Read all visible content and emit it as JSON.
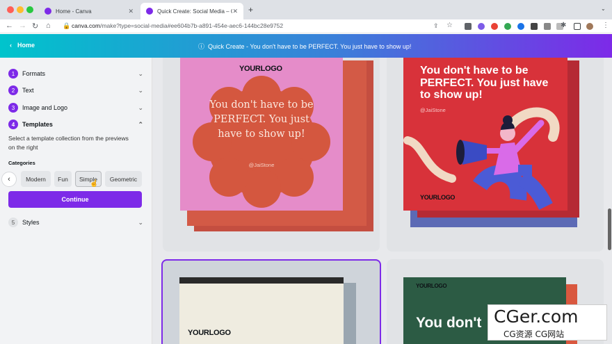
{
  "browser": {
    "tabs": [
      {
        "title": "Home - Canva"
      },
      {
        "title": "Quick Create: Social Media – C"
      }
    ],
    "new_tab": "+",
    "url_host": "canva.com",
    "url_rest": "/make?type=social-media#ee604b7b-a891-454e-aec6-144bc28e9752"
  },
  "banner": {
    "home_label": "Home",
    "message": "Quick Create - You don't have to be PERFECT. You just have to show up!"
  },
  "sidebar": {
    "steps": [
      {
        "num": "1",
        "label": "Formats"
      },
      {
        "num": "2",
        "label": "Text"
      },
      {
        "num": "3",
        "label": "Image and Logo"
      },
      {
        "num": "4",
        "label": "Templates"
      },
      {
        "num": "5",
        "label": "Styles"
      }
    ],
    "description": "Select a template collection from the previews on the right",
    "categories_label": "Categories",
    "categories": [
      "Modern",
      "Fun",
      "Simple",
      "Geometric"
    ],
    "continue_label": "Continue"
  },
  "templates": {
    "card1": {
      "logo_a": "YOUR",
      "logo_b": "LOGO",
      "quote": "You don't have to be PERFECT. You just have to show up!",
      "handle": "@JaiStone"
    },
    "card2": {
      "quote": "You don't have to be PERFECT. You just have to show up!",
      "handle": "@JaiStone",
      "logo_a": "YOUR",
      "logo_b": "LOGO"
    },
    "card3": {
      "logo_a": "YOUR",
      "logo_b": "LOGO"
    },
    "card4": {
      "logo_a": "YOUR",
      "logo_b": "LOGO",
      "quote": "You don't"
    }
  },
  "watermark": {
    "big": "CGer.com",
    "small": "CG资源 CG网站"
  },
  "colors": {
    "accent": "#7d2ae8",
    "teal": "#00c4cc"
  }
}
